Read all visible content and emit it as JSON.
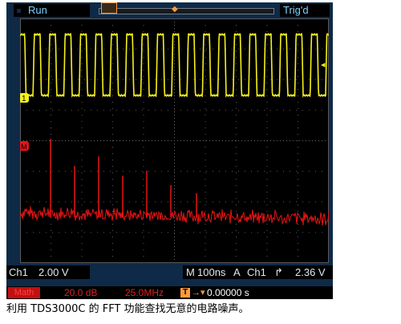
{
  "topbar": {
    "run_label": "Run",
    "trig_label": "Trig'd"
  },
  "screen": {
    "ch1_marker": "1",
    "math_marker": "M",
    "trigger_level_marker": "◂"
  },
  "status": {
    "ch1_label": "Ch1",
    "ch1_scale": "2.00 V",
    "timebase_label": "M",
    "timebase_value": "100ns",
    "trigger_mode": "A",
    "trigger_source": "Ch1",
    "trigger_slope_symbol": "∳",
    "trigger_level": "2.36 V"
  },
  "math": {
    "label": "Math",
    "scale": "20.0 dB",
    "span": "25.0MHz",
    "trigger_t": "T",
    "trigger_arrow": "→▾",
    "position": "0.00000 s"
  },
  "colors": {
    "ch1": "#f5f11a",
    "math": "#e81414",
    "accent": "#ff9a3c",
    "bezel": "#0e2a47"
  },
  "caption": "利用 TDS3000C 的 FFT 功能查找无意的电路噪声。"
}
